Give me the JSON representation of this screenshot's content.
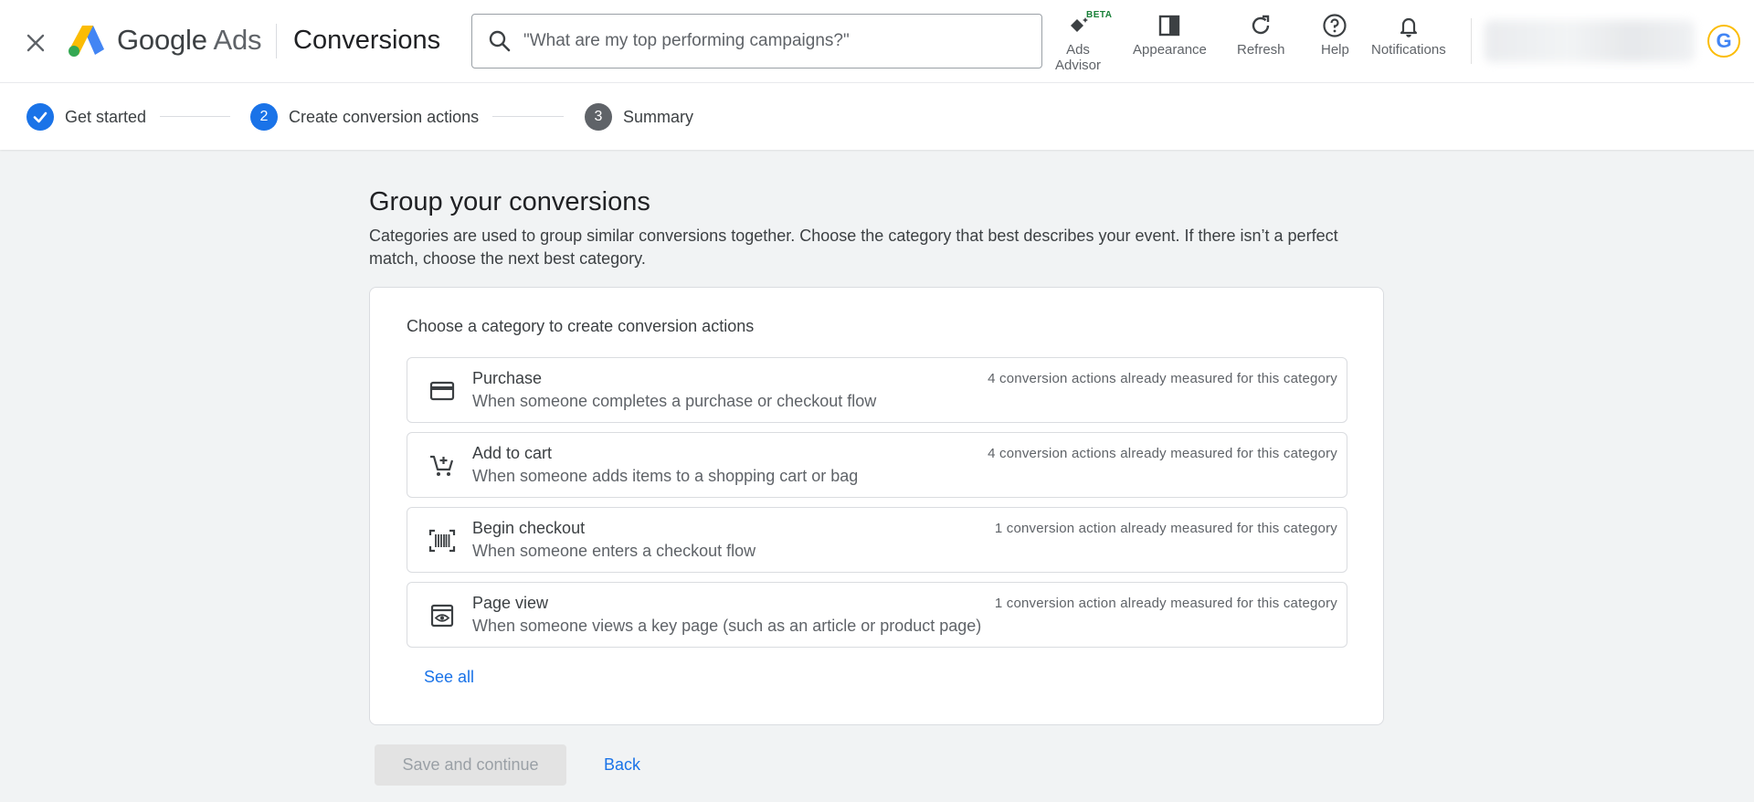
{
  "header": {
    "brand_google": "Google",
    "brand_ads": "Ads",
    "page_title": "Conversions",
    "search_placeholder": "\"What are my top performing campaigns?\"",
    "tools": [
      {
        "label": "Ads\nAdvisor",
        "badge": "BETA",
        "icon": "sparkle-diamond-icon"
      },
      {
        "label": "Appearance",
        "icon": "appearance-icon"
      },
      {
        "label": "Refresh",
        "icon": "refresh-icon"
      },
      {
        "label": "Help",
        "icon": "help-circle-icon"
      },
      {
        "label": "Notifications",
        "icon": "bell-icon"
      }
    ],
    "avatar_letter": "G"
  },
  "stepper": {
    "steps": [
      {
        "number": "",
        "label": "Get started",
        "state": "done"
      },
      {
        "number": "2",
        "label": "Create conversion actions",
        "state": "active"
      },
      {
        "number": "3",
        "label": "Summary",
        "state": "pending"
      }
    ]
  },
  "main": {
    "title": "Group your conversions",
    "description": "Categories are used to group similar conversions together. Choose the category that best describes your event. If there isn’t a perfect match, choose the next best category.",
    "card_heading": "Choose a category to create conversion actions",
    "options": [
      {
        "title": "Purchase",
        "desc": "When someone completes a purchase or checkout flow",
        "count": "4 conversion actions already measured for this category",
        "icon": "credit-card-icon"
      },
      {
        "title": "Add to cart",
        "desc": "When someone adds items to a shopping cart or bag",
        "count": "4 conversion actions already measured for this category",
        "icon": "add-shopping-cart-icon"
      },
      {
        "title": "Begin checkout",
        "desc": "When someone enters a checkout flow",
        "count": "1 conversion action already measured for this category",
        "icon": "barcode-scanner-icon"
      },
      {
        "title": "Page view",
        "desc": "When someone views a key page (such as an article or product page)",
        "count": "1 conversion action already measured for this category",
        "icon": "page-view-eye-icon"
      }
    ],
    "see_all": "See all",
    "save_label": "Save and continue",
    "back_label": "Back"
  },
  "colors": {
    "accent": "#1a73e8",
    "background": "#f1f3f4"
  }
}
